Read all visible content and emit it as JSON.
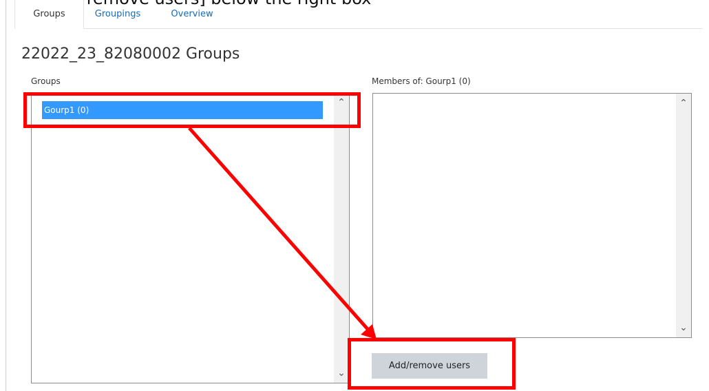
{
  "instruction": "• [Add/remove users] below the right box",
  "tabs": [
    {
      "label": "Groups"
    },
    {
      "label": "Groupings"
    },
    {
      "label": "Overview"
    }
  ],
  "page_title": "22022_23_82080002 Groups",
  "groups_panel": {
    "label": "Groups",
    "options": [
      {
        "label": "Gourp1 (0)"
      }
    ]
  },
  "members_panel": {
    "label": "Members of: Gourp1 (0)"
  },
  "add_remove_button": {
    "label": "Add/remove users"
  },
  "icons": {
    "scroll_up": "chevron-up-icon",
    "scroll_down": "chevron-down-icon"
  },
  "colors": {
    "link": "#0f6cbf",
    "selected": "#3399ff",
    "button": "#ced4da",
    "annotation": "#ff0000"
  }
}
